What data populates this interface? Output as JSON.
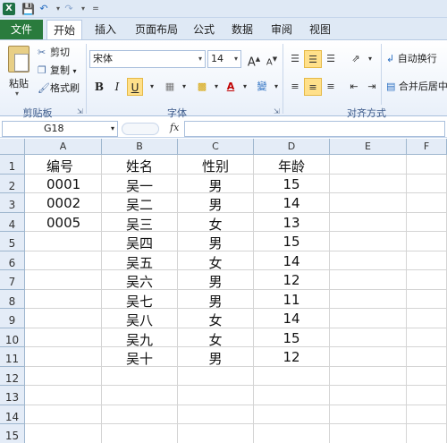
{
  "quick_access": {
    "customize": "="
  },
  "tabs": {
    "file": "文件",
    "items": [
      "开始",
      "插入",
      "页面布局",
      "公式",
      "数据",
      "审阅",
      "视图"
    ],
    "active_index": 0
  },
  "clipboard": {
    "paste": "粘贴",
    "cut": "剪切",
    "copy": "复制",
    "format_painter": "格式刷",
    "group": "剪贴板"
  },
  "font": {
    "name": "宋体",
    "size": "14",
    "bold": "B",
    "italic": "I",
    "underline": "U",
    "grow": "A",
    "shrink": "A",
    "group": "字体",
    "phonetic": "變"
  },
  "alignment": {
    "wrap": "自动换行",
    "merge": "合并后居中",
    "group": "对齐方式"
  },
  "formula_bar": {
    "name_box": "G18",
    "fx": "fx",
    "value": ""
  },
  "columns": [
    "A",
    "B",
    "C",
    "D",
    "E",
    "F"
  ],
  "rows": [
    "1",
    "2",
    "3",
    "4",
    "5",
    "6",
    "7",
    "8",
    "9",
    "10",
    "11",
    "12",
    "13",
    "14",
    "15"
  ],
  "headers": [
    "编号",
    "姓名",
    "性别",
    "年龄"
  ],
  "records": [
    [
      "0001",
      "吴一",
      "男",
      "15"
    ],
    [
      "0002",
      "吴二",
      "男",
      "14"
    ],
    [
      "0005",
      "吴三",
      "女",
      "13"
    ],
    [
      "",
      "吴四",
      "男",
      "15"
    ],
    [
      "",
      "吴五",
      "女",
      "14"
    ],
    [
      "",
      "吴六",
      "男",
      "12"
    ],
    [
      "",
      "吴七",
      "男",
      "11"
    ],
    [
      "",
      "吴八",
      "女",
      "14"
    ],
    [
      "",
      "吴九",
      "女",
      "15"
    ],
    [
      "",
      "吴十",
      "男",
      "12"
    ]
  ]
}
